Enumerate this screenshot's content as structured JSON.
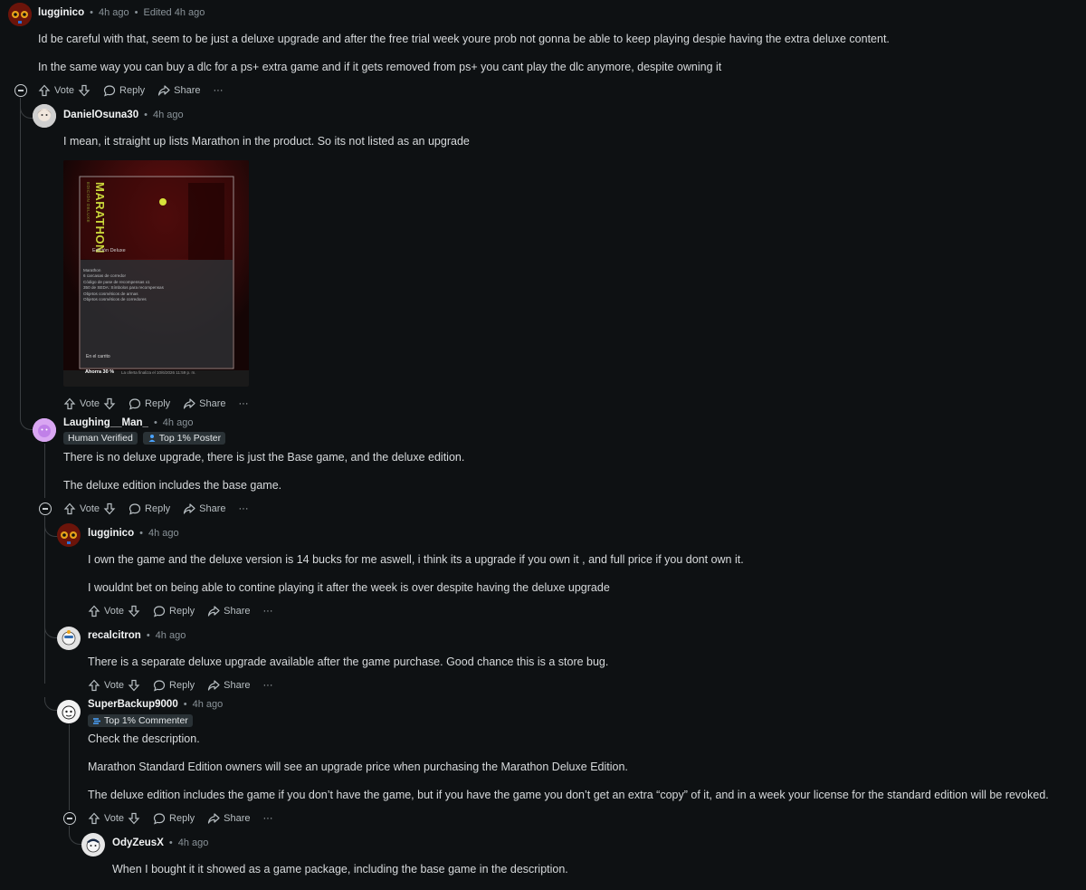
{
  "actions": {
    "vote": "Vote",
    "reply": "Reply",
    "share": "Share",
    "more": "···"
  },
  "comments": [
    {
      "user": "lugginico",
      "time": "4h ago",
      "edited": "Edited 4h ago",
      "lines": [
        "Id be careful with that, seem to be just a deluxe upgrade and after the free trial week youre prob not gonna be able to keep playing despie having the extra deluxe content.",
        "In the same way you can buy a dlc for a ps+ extra game and if it gets removed from ps+ you cant play the dlc anymore, despite owning it"
      ]
    },
    {
      "user": "DanielOsuna30",
      "time": "4h ago",
      "lines": [
        "I mean, it straight up lists Marathon in the product. So its not listed as an upgrade"
      ],
      "image": {
        "title": "MARATHON",
        "subtitle": "EDICIÓN DELUXE",
        "edition": "Edición Deluxe",
        "items": [
          "Marathon",
          "6 carcasas de corredor",
          "Código de pase de recompensas x1",
          "350 de SEDA: Símbolos para recompensas",
          "Objetos cosméticos de armas",
          "Objetos cosméticos de corredores"
        ],
        "cart": "En el carrito",
        "discount": "Ahorra 30 %",
        "offer": "La oferta finaliza el 10/6/2026 11:59 p. m."
      }
    },
    {
      "user": "Laughing__Man_",
      "time": "4h ago",
      "flairs": [
        "Human Verified",
        "Top 1% Poster"
      ],
      "lines": [
        "There is no deluxe upgrade, there is just the Base game, and the deluxe edition.",
        "The deluxe edition includes the base game."
      ]
    },
    {
      "user": "lugginico",
      "time": "4h ago",
      "lines": [
        "I own the game and the deluxe version is 14 bucks for me aswell, i think its a upgrade if you own it , and full price if you dont own it.",
        "I wouldnt bet on being able to contine playing it after the week is over despite having the deluxe upgrade"
      ]
    },
    {
      "user": "recalcitron",
      "time": "4h ago",
      "lines": [
        "There is a separate deluxe upgrade available after the game purchase. Good chance this is a store bug."
      ]
    },
    {
      "user": "SuperBackup9000",
      "time": "4h ago",
      "flairs": [
        "Top 1% Commenter"
      ],
      "lines": [
        "Check the description.",
        "Marathon Standard Edition owners will see an upgrade price when purchasing the Marathon Deluxe Edition.",
        "The deluxe edition includes the game if you don’t have the game, but if you have the game you don’t get an extra “copy” of it, and in a week your license for the standard edition will be revoked."
      ]
    },
    {
      "user": "OdyZeusX",
      "time": "4h ago",
      "lines": [
        "When I bought it it showed as a game package, including the base game in the description."
      ]
    }
  ]
}
